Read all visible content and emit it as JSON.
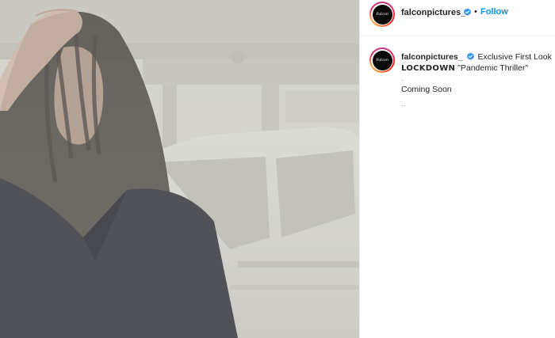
{
  "post": {
    "account": {
      "username": "falconpictures_",
      "verified": true,
      "avatar_logo_text": "Falcon"
    },
    "header": {
      "separator": "•",
      "follow_label": "Follow"
    },
    "caption": {
      "username": "falconpictures_",
      "line1": "Exclusive First Look",
      "title_word": "LOCKDOWN",
      "quoted": "\"Pandemic Thriller\"",
      "dot_line": ".",
      "coming_soon": "Coming Soon",
      "trailing": ".."
    }
  },
  "colors": {
    "accent_blue": "#0095f6",
    "text": "#262626",
    "muted": "#8e8e8e",
    "verified_badge": "#3897f0",
    "border": "#efefef"
  },
  "icons": {
    "verified": "verified-badge-icon"
  }
}
